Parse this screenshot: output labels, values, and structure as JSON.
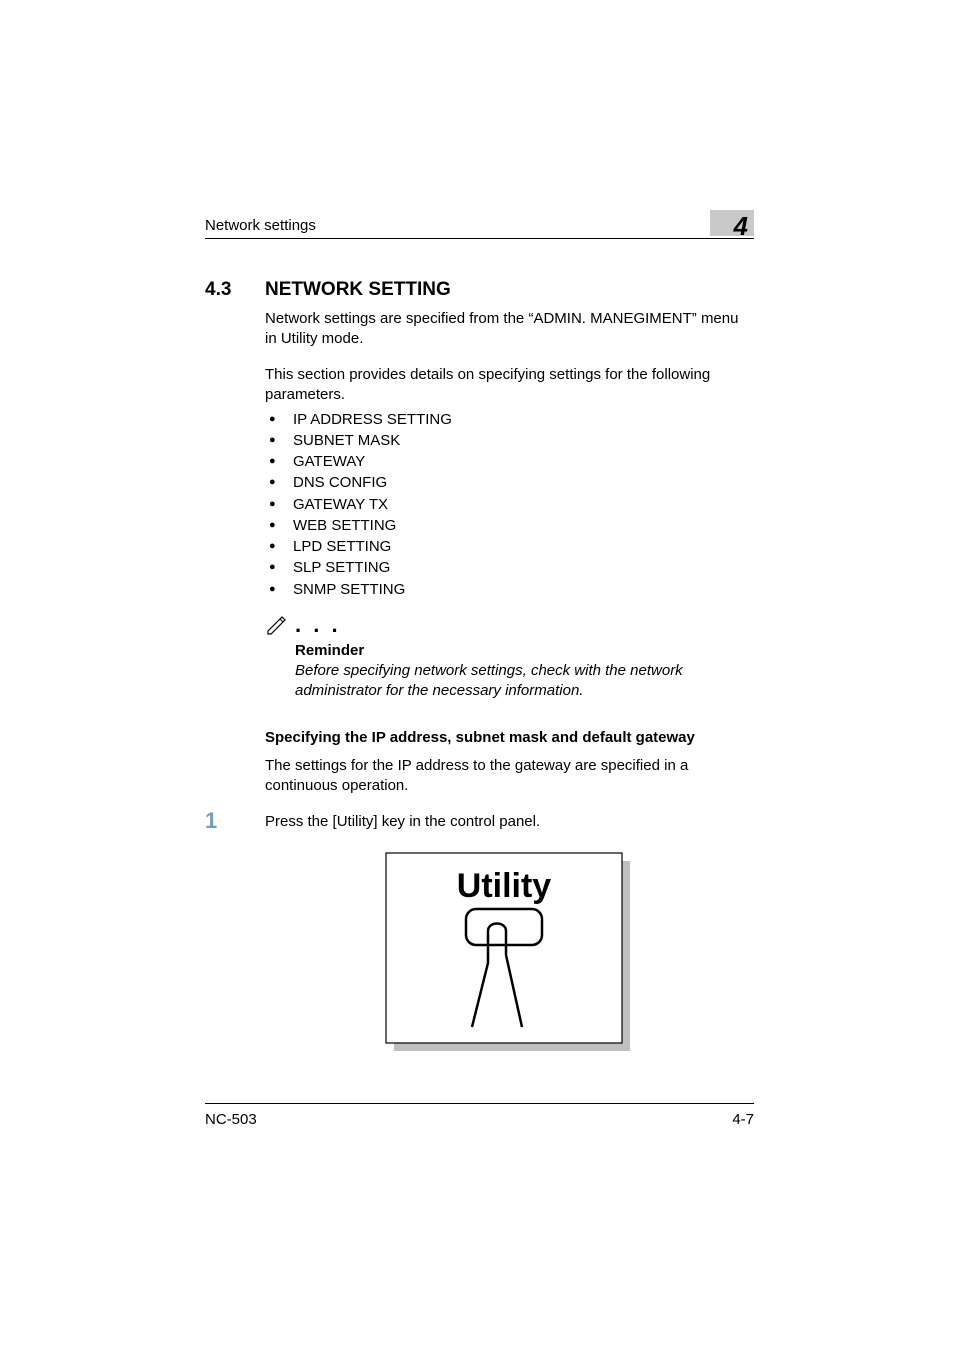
{
  "header": {
    "running_title": "Network settings",
    "chapter_number": "4"
  },
  "section": {
    "number": "4.3",
    "title": "NETWORK SETTING"
  },
  "intro_para_1": "Network settings are specified from the “ADMIN. MANEGIMENT” menu in Utility mode.",
  "intro_para_2": "This section provides details on specifying settings for the following parameters.",
  "bullets": [
    "IP ADDRESS SETTING",
    "SUBNET MASK",
    "GATEWAY",
    "DNS CONFIG",
    "GATEWAY TX",
    "WEB SETTING",
    "LPD SETTING",
    "SLP SETTING",
    "SNMP SETTING"
  ],
  "note": {
    "dots": ". . .",
    "label": "Reminder",
    "text": "Before specifying network settings, check with the network administrator for the necessary information."
  },
  "subheading": "Specifying the IP address, subnet mask and default gateway",
  "sub_para": "The settings for the IP address to the gateway are specified in a continuous operation.",
  "step": {
    "number": "1",
    "text": "Press the [Utility] key in the control panel."
  },
  "utility_label": "Utility",
  "footer": {
    "model": "NC-503",
    "page": "4-7"
  }
}
